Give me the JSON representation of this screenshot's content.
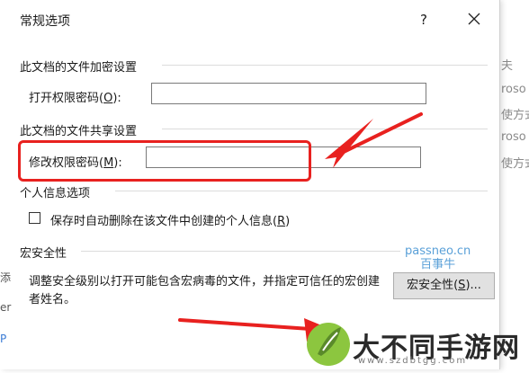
{
  "background": {
    "right_fragments": [
      "夫",
      "roso",
      "使方式",
      "roso",
      "使方式"
    ],
    "left_fragments": [
      "添",
      "er",
      "P"
    ]
  },
  "dialog": {
    "title": "常规选项",
    "help": "?",
    "encryption": {
      "heading": "此文档的文件加密设置",
      "open_password_label": "打开权限密码(",
      "open_password_key": "O",
      "open_password_tail": "):",
      "open_password_value": ""
    },
    "sharing": {
      "heading": "此文档的文件共享设置",
      "modify_password_label": "修改权限密码(",
      "modify_password_key": "M",
      "modify_password_tail": "):",
      "modify_password_value": ""
    },
    "privacy": {
      "heading": "个人信息选项",
      "remove_info_label": "保存时自动删除在该文件中创建的个人信息(",
      "remove_info_key": "R",
      "remove_info_tail": ")",
      "checked": false
    },
    "macro": {
      "heading": "宏安全性",
      "description": "调整安全级别以打开可能包含宏病毒的文件，并指定可信任的宏创建者姓名。",
      "button_label": "宏安全性(",
      "button_key": "S",
      "button_tail": ")..."
    }
  },
  "overlay": {
    "watermark_line1": "passneo.cn",
    "watermark_line2": "百事牛",
    "logo_text": "大不同手游网",
    "logo_url": "www.szdbtgg.com",
    "highlight_color": "#e8211f"
  }
}
